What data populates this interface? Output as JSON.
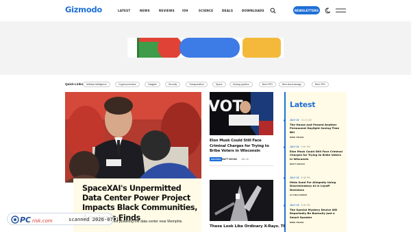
{
  "header": {
    "logo": "Gizmodo",
    "nav": [
      "LATEST",
      "NEWS",
      "REVIEWS",
      "IO9",
      "SCIENCE",
      "DEALS",
      "DOWNLOADS"
    ],
    "newsletters_label": "NEWSLETTERS"
  },
  "quick_links": {
    "label": "Quick Links",
    "items": [
      "Artificial intelligence",
      "Cryptocurrencies",
      "Gadgets",
      "Security",
      "Transportation",
      "Space",
      "Moving spoilers",
      "Best VPN",
      "Best cloud storage",
      "Best VPN"
    ]
  },
  "hero": {
    "title": "SpaceXAI's Unpermitted Data Center Power Project Impacts Black Communities, Analysis Finds",
    "dek": "...stop the gas turbines powering the data center near Memphis."
  },
  "stories": [
    {
      "title": "Elon Musk Could Still Face Criminal Charges for Trying to Bribe Voters in Wisconsin",
      "tag": "POLITICS",
      "author": "MATT NOVAK",
      "date": "JUL 16"
    },
    {
      "title": "These Look Like Ordinary X-Rays. They're"
    }
  ],
  "latest": {
    "title": "Latest",
    "items": [
      {
        "date": "JULY 16",
        "time": "10:13 AM",
        "title": "The House Just Passed Another Permanent Daylight Saving Time Bill",
        "author": "MIKE PEARL"
      },
      {
        "date": "JULY 16",
        "time": "9:50 PM",
        "title": "Elon Musk Could Still Face Criminal Charges for Trying to Bribe Voters in Wisconsin",
        "author": "MATT NOVAK"
      },
      {
        "date": "JULY 15",
        "time": "8:38 PM",
        "title": "Meta Sued For Allegedly Using Discriminatory AI in Layoff Decisions",
        "author": "AJ DELLINGER"
      },
      {
        "date": "JULY 15",
        "time": "8:08 PM",
        "title": "The Special Mystery Device WD Reportedly Be Basically Just a Smart Speaker",
        "author": "MIKE PEARL"
      }
    ]
  },
  "watermark": {
    "brand": "PCrisk.com",
    "scan_text": "scanned 2026-07-15"
  },
  "colors": {
    "brand_blue": "#1f6fd6",
    "latest_bg": "#fffbe6"
  }
}
